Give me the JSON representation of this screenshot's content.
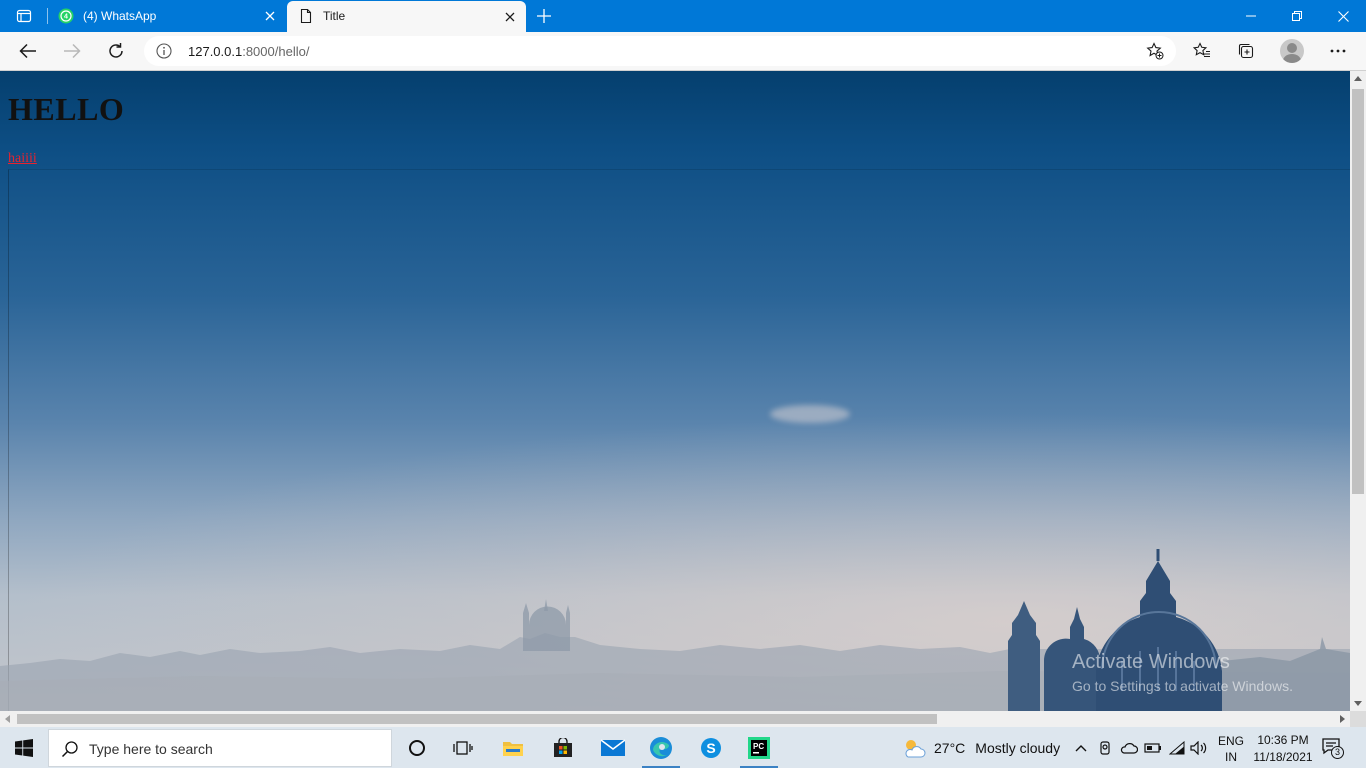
{
  "browser": {
    "tabs": [
      {
        "title": "(4) WhatsApp",
        "badge": "4",
        "active": false
      },
      {
        "title": "Title",
        "active": true
      }
    ],
    "url_host": "127.0.0.1",
    "url_path": ":8000/hello/"
  },
  "page": {
    "heading": "HELLO",
    "link_text": "haiiii"
  },
  "watermark": {
    "line1": "Activate Windows",
    "line2": "Go to Settings to activate Windows."
  },
  "taskbar": {
    "search_placeholder": "Type here to search",
    "weather_temp": "27°C",
    "weather_text": "Mostly cloudy",
    "lang_line1": "ENG",
    "lang_line2": "IN",
    "time": "10:36 PM",
    "date": "11/18/2021",
    "notification_count": "3"
  },
  "colors": {
    "titlebar": "#0078d7",
    "link": "#e8222e",
    "pycharm": "#21d789",
    "whatsapp": "#25d366"
  }
}
